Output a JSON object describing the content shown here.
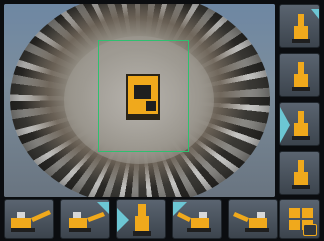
{
  "app": {
    "main_view_icon": "camera-surround-view",
    "accent": "#f0a91c",
    "guide_color": "#2fbf6f"
  },
  "sidebar": {
    "items": [
      {
        "icon": "camera-front-right-icon"
      },
      {
        "icon": "camera-right-icon"
      },
      {
        "icon": "camera-rear-icon"
      },
      {
        "icon": "camera-overhead-icon"
      }
    ]
  },
  "bottom_bar": {
    "items": [
      {
        "icon": "camera-left-side-icon"
      },
      {
        "icon": "camera-left-angle-icon"
      },
      {
        "icon": "camera-top-icon"
      },
      {
        "icon": "camera-rear-left-icon"
      },
      {
        "icon": "camera-side-icon"
      }
    ],
    "windows_button_icon": "windows-icon"
  }
}
